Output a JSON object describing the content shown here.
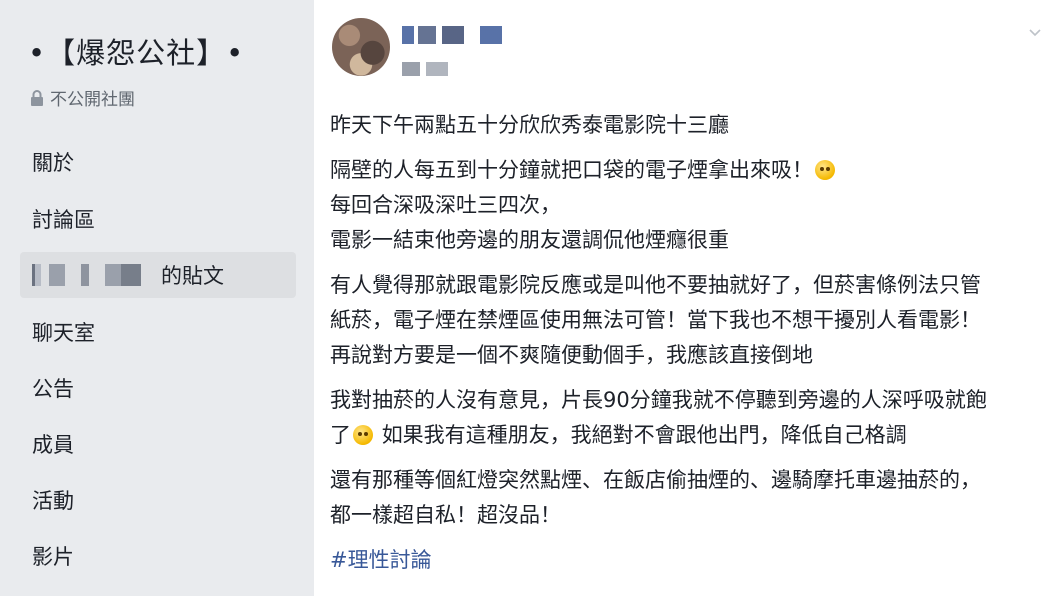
{
  "sidebar": {
    "group_title": "•【爆怨公社】•",
    "privacy_label": "不公開社團",
    "items": [
      {
        "label": "關於"
      },
      {
        "label": "討論區"
      },
      {
        "label": "的貼文"
      },
      {
        "label": "聊天室"
      },
      {
        "label": "公告"
      },
      {
        "label": "成員"
      },
      {
        "label": "活動"
      },
      {
        "label": "影片"
      }
    ]
  },
  "post": {
    "paragraphs": [
      [
        "昨天下午兩點五十分欣欣秀泰電影院十三廳"
      ],
      [
        "隔壁的人每五到十分鐘就把口袋的電子煙拿出來吸！",
        "每回合深吸深吐三四次，",
        "電影一結束他旁邊的朋友還調侃他煙癮很重"
      ],
      [
        "有人覺得那就跟電影院反應或是叫他不要抽就好了，但菸害條例法只管",
        "紙菸，電子煙在禁煙區使用無法可管！當下我也不想干擾別人看電影！",
        "再說對方要是一個不爽隨便動個手，我應該直接倒地"
      ],
      [
        "我對抽菸的人沒有意見，片長90分鐘我就不停聽到旁邊的人深呼吸就飽",
        "了",
        "如果我有這種朋友，我絕對不會跟他出門，降低自己格調"
      ],
      [
        "還有那種等個紅燈突然點煙、在飯店偷抽煙的、邊騎摩托車邊抽菸的，",
        "都一樣超自私！超沒品！"
      ]
    ],
    "hashtag": "#理性討論",
    "icons": [
      "lock-icon",
      "chevron-down-icon",
      "emoji-icon"
    ]
  }
}
